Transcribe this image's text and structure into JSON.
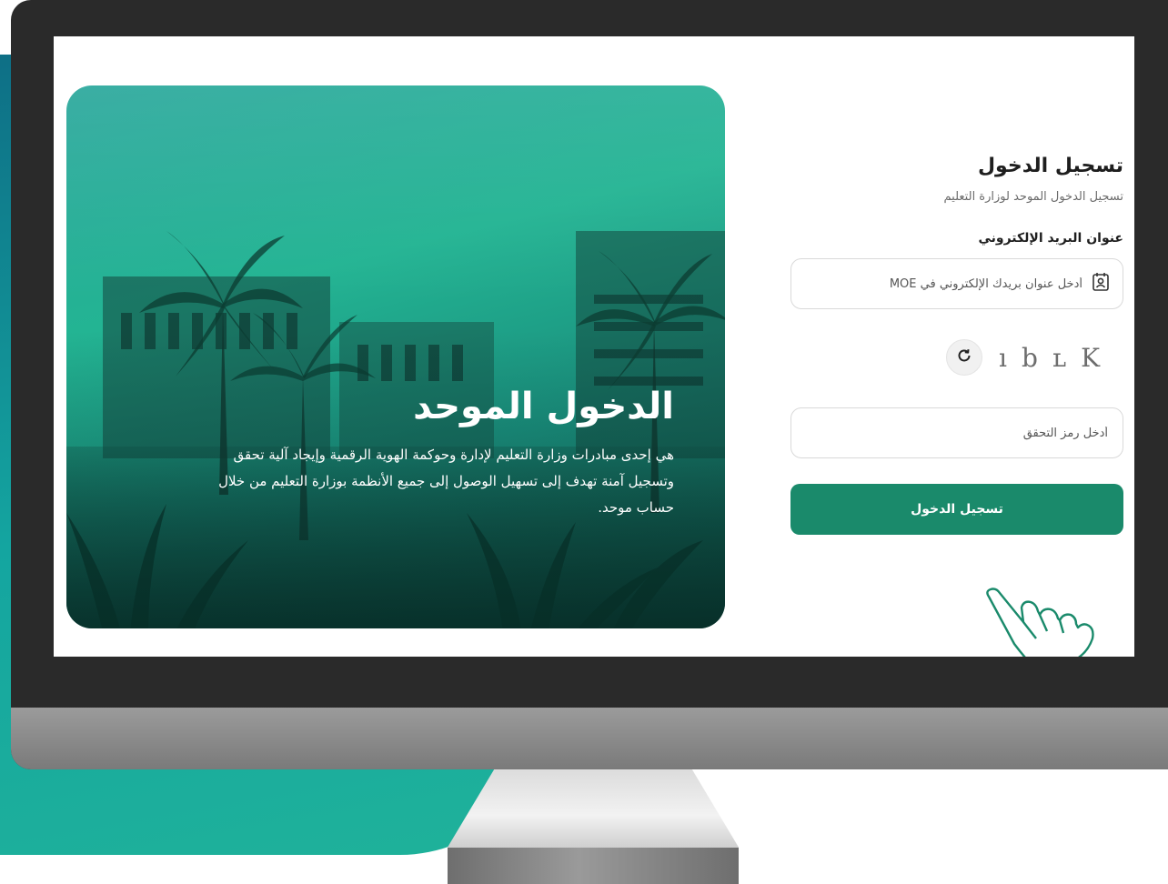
{
  "hero": {
    "title": "الدخول الموحد",
    "description": "هي إحدى مبادرات وزارة التعليم لإدارة وحوكمة الهوية الرقمية وإيجاد آلية تحقق وتسجيل آمنة تهدف إلى تسهيل الوصول إلى جميع الأنظمة بوزارة التعليم من خلال حساب موحد."
  },
  "login": {
    "title": "تسجيل الدخول",
    "subtitle": "تسجيل الدخول الموحد لوزارة التعليم",
    "email_label": "عنوان البريد الإلكتروني",
    "email_placeholder": "أدخل عنوان بريدك الإلكتروني في MOE",
    "email_value": "",
    "captcha_text": "ıbʟK",
    "captcha_placeholder": "أدخل رمز التحقق",
    "captcha_value": "",
    "submit_label": "تسجيل الدخول"
  },
  "icons": {
    "email": "contact-card-icon",
    "refresh": "refresh-icon",
    "pointer": "hand-pointer-icon"
  },
  "colors": {
    "accent": "#1a8a6b",
    "backdrop": "#14a5a0",
    "bezel": "#2a2a2a"
  }
}
